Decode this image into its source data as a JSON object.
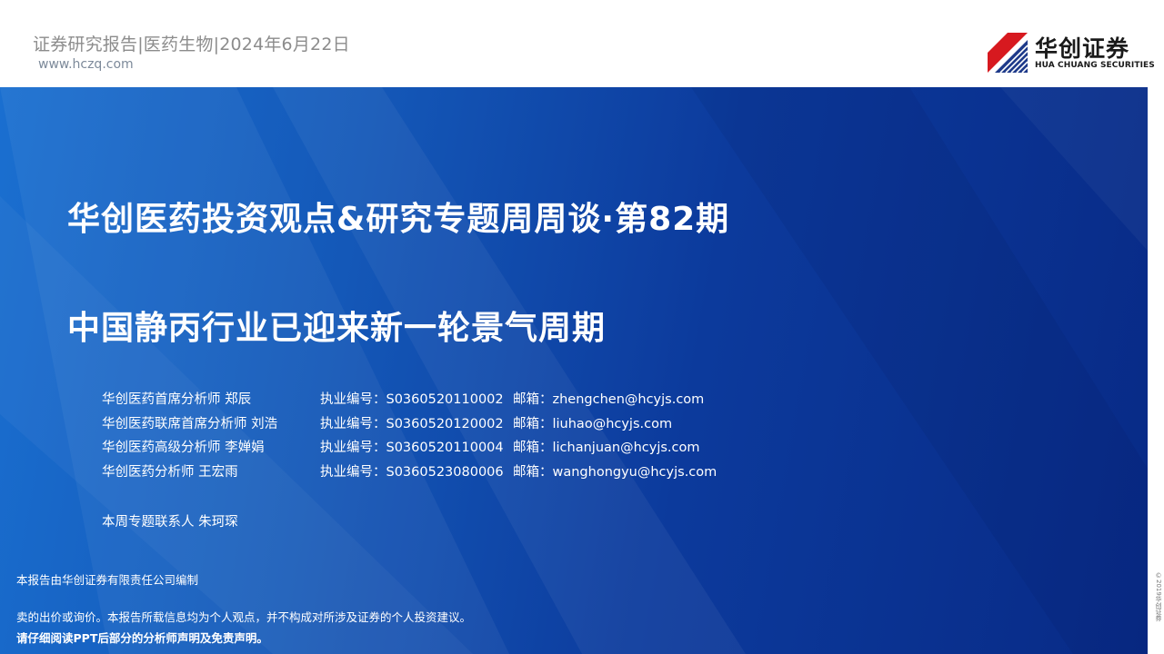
{
  "header": {
    "report_line": "证券研究报告|医药生物|2024年6月22日",
    "website": "www.hczq.com"
  },
  "logo": {
    "name_cn": "华创证券",
    "name_en": "HUA CHUANG SECURITIES",
    "icon": "hcz-logo-icon",
    "colors": [
      "#d7191f",
      "#1e3a8a"
    ]
  },
  "title": {
    "line1": "华创医药投资观点&研究专题周周谈·第82期",
    "line2": "中国静丙行业已迎来新一轮景气周期"
  },
  "analysts": [
    {
      "role_name": "华创医药首席分析师 郑辰",
      "license": "执业编号：S0360520110002",
      "email": "邮箱：zhengchen@hcyjs.com"
    },
    {
      "role_name": "华创医药联席首席分析师 刘浩",
      "license": "执业编号：S0360520120002",
      "email": "邮箱：liuhao@hcyjs.com"
    },
    {
      "role_name": "华创医药高级分析师 李婵娟",
      "license": "执业编号：S0360520110004",
      "email": "邮箱：lichanjuan@hcyjs.com"
    },
    {
      "role_name": "华创医药分析师 王宏雨",
      "license": "执业编号：S0360523080006",
      "email": "邮箱：wanghongyu@hcyjs.com"
    }
  ],
  "contact": "本周专题联系人 朱珂琛",
  "issuer": "本报告由华创证券有限责任公司编制",
  "disclaimer_1": "卖的出价或询价。本报告所载信息均为个人观点，并不构成对所涉及证券的个人投资建议。",
  "disclaimer_2": "请仔细阅读PPT后部分的分析师声明及免责声明。",
  "side_note": "©2019华创证券",
  "colors": {
    "banner_start": "#1a6fd0",
    "banner_end": "#082a86",
    "header_text": "#8c8c8c"
  }
}
